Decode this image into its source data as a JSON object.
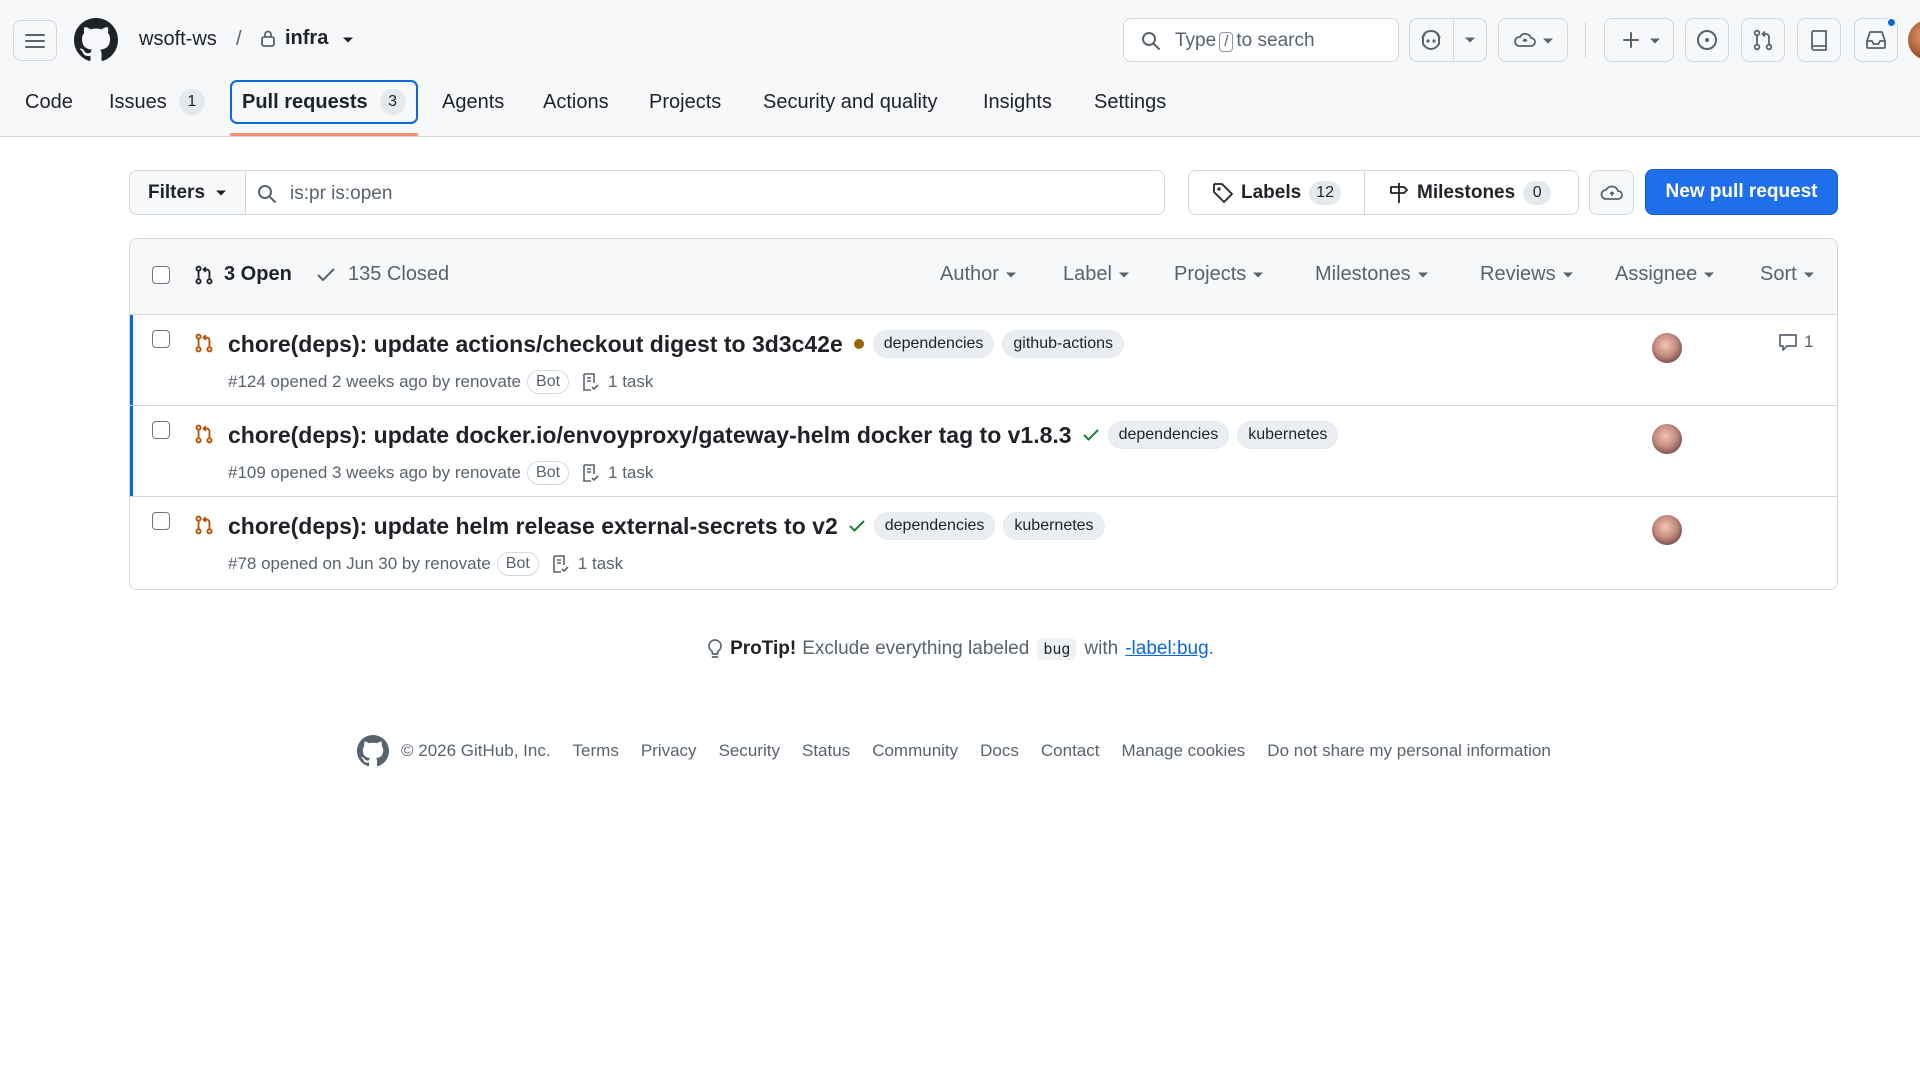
{
  "header": {
    "owner": "wsoft-ws",
    "separator": "/",
    "repo": "infra",
    "search": {
      "prefix": "Type",
      "key": "/",
      "suffix": "to search"
    }
  },
  "tabs": [
    {
      "label": "Code"
    },
    {
      "label": "Issues",
      "count": "1"
    },
    {
      "label": "Pull requests",
      "count": "3",
      "selected": true
    },
    {
      "label": "Agents"
    },
    {
      "label": "Actions"
    },
    {
      "label": "Projects"
    },
    {
      "label": "Security and quality"
    },
    {
      "label": "Insights"
    },
    {
      "label": "Settings"
    }
  ],
  "filterbar": {
    "filters_label": "Filters",
    "query": "is:pr is:open",
    "labels_label": "Labels",
    "labels_count": "12",
    "milestones_label": "Milestones",
    "milestones_count": "0",
    "new_pr_label": "New pull request"
  },
  "list": {
    "open_label": "3 Open",
    "closed_label": "135 Closed",
    "sorters": [
      "Author",
      "Label",
      "Projects",
      "Milestones",
      "Reviews",
      "Assignee",
      "Sort"
    ],
    "rows": [
      {
        "title": "chore(deps): update actions/checkout digest to 3d3c42e",
        "status": "pending",
        "labels": [
          "dependencies",
          "github-actions"
        ],
        "meta": "#124 opened 2 weeks ago by renovate",
        "bot": "Bot",
        "task": "1 task",
        "comments": "1"
      },
      {
        "title": "chore(deps): update docker.io/envoyproxy/gateway-helm docker tag to v1.8.3",
        "status": "success",
        "labels": [
          "dependencies",
          "kubernetes"
        ],
        "meta": "#109 opened 3 weeks ago by renovate",
        "bot": "Bot",
        "task": "1 task"
      },
      {
        "title": "chore(deps): update helm release external-secrets to v2",
        "status": "success",
        "labels": [
          "dependencies",
          "kubernetes"
        ],
        "meta": "#78 opened on Jun 30 by renovate",
        "bot": "Bot",
        "task": "1 task"
      }
    ]
  },
  "protip": {
    "strong": "ProTip!",
    "text1": "Exclude everything labeled",
    "code": "bug",
    "text2": "with",
    "link": "-label:bug",
    "end": "."
  },
  "footer": {
    "copyright": "© 2026 GitHub, Inc.",
    "links": [
      "Terms",
      "Privacy",
      "Security",
      "Status",
      "Community",
      "Docs",
      "Contact",
      "Manage cookies",
      "Do not share my personal information"
    ]
  },
  "colors": {
    "accent": "#0969da",
    "primary_button": "#1f6feb",
    "open_pr": "#bc4c00",
    "pending": "#9a6700",
    "success": "#1a7f37"
  }
}
